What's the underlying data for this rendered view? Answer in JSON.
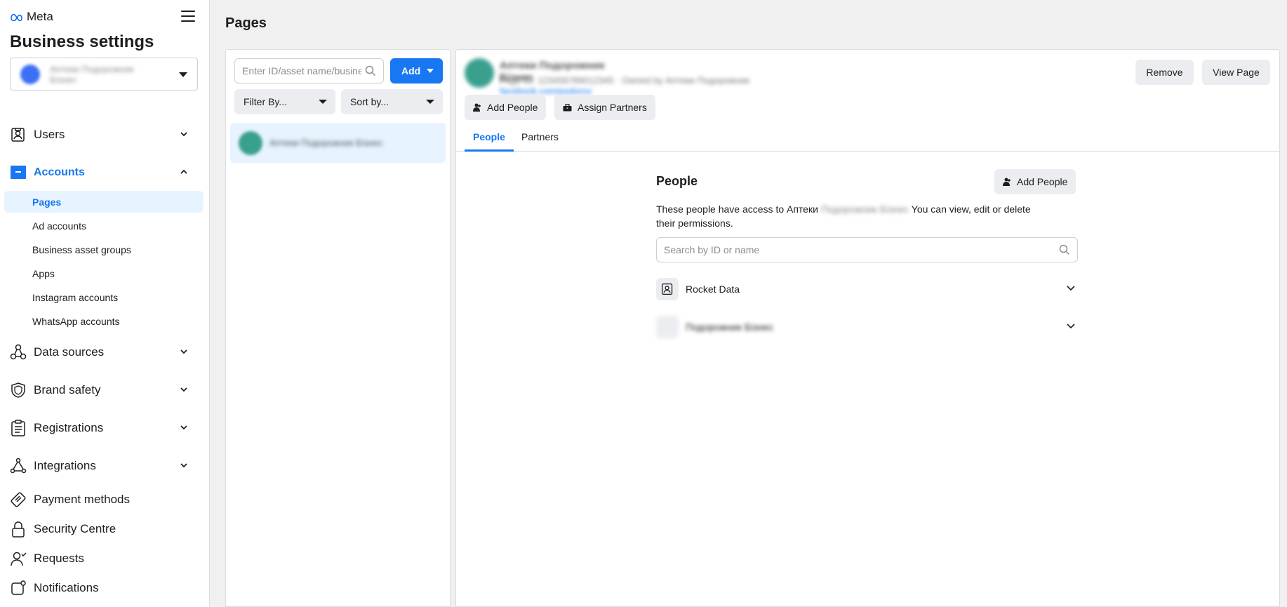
{
  "sidebar": {
    "brand": "Meta",
    "title": "Business settings",
    "business_name": "Аптеки Подорожник Бізнес",
    "nav": [
      {
        "label": "Users",
        "icon": "users-badge-icon"
      },
      {
        "label": "Accounts",
        "icon": "accounts-briefcase-icon"
      },
      {
        "label": "Data sources",
        "icon": "data-sources-icon"
      },
      {
        "label": "Brand safety",
        "icon": "shield-icon"
      },
      {
        "label": "Registrations",
        "icon": "clipboard-icon"
      },
      {
        "label": "Integrations",
        "icon": "integrations-icon"
      },
      {
        "label": "Payment methods",
        "icon": "payment-card-icon"
      },
      {
        "label": "Security Centre",
        "icon": "lock-icon"
      },
      {
        "label": "Requests",
        "icon": "person-check-icon"
      },
      {
        "label": "Notifications",
        "icon": "notification-icon"
      }
    ],
    "accounts_sub": [
      {
        "label": "Pages"
      },
      {
        "label": "Ad accounts"
      },
      {
        "label": "Business asset groups"
      },
      {
        "label": "Apps"
      },
      {
        "label": "Instagram accounts"
      },
      {
        "label": "WhatsApp accounts"
      }
    ]
  },
  "main": {
    "title": "Pages",
    "list": {
      "search_placeholder": "Enter ID/asset name/business name",
      "add_label": "Add",
      "filter_label": "Filter By...",
      "sort_label": "Sort by...",
      "items": [
        {
          "name": "Аптеки Подорожник Бізнес"
        }
      ]
    },
    "detail": {
      "page_name": "Аптеки Подорожник Бізнес",
      "page_meta": "Page ID: 123456789012345 · Owned by Аптеки Подорожник",
      "page_link": "facebook.com/podoroz",
      "remove_label": "Remove",
      "view_page_label": "View Page",
      "add_people_label": "Add People",
      "assign_partners_label": "Assign Partners",
      "tabs": [
        {
          "label": "People"
        },
        {
          "label": "Partners"
        }
      ],
      "people": {
        "title": "People",
        "add_label": "Add People",
        "desc_prefix": "These people have access to Аптеки",
        "desc_blurred": "Подорожник Бізнес",
        "desc_suffix": "You can view, edit or delete their permissions.",
        "search_placeholder": "Search by ID or name",
        "rows": [
          {
            "name": "Rocket Data"
          },
          {
            "name": "Подорожник Бізнес"
          }
        ]
      }
    }
  },
  "colors": {
    "accent": "#1877f2",
    "selected_bg": "#e7f3ff",
    "button_grey": "#ebedf0"
  }
}
